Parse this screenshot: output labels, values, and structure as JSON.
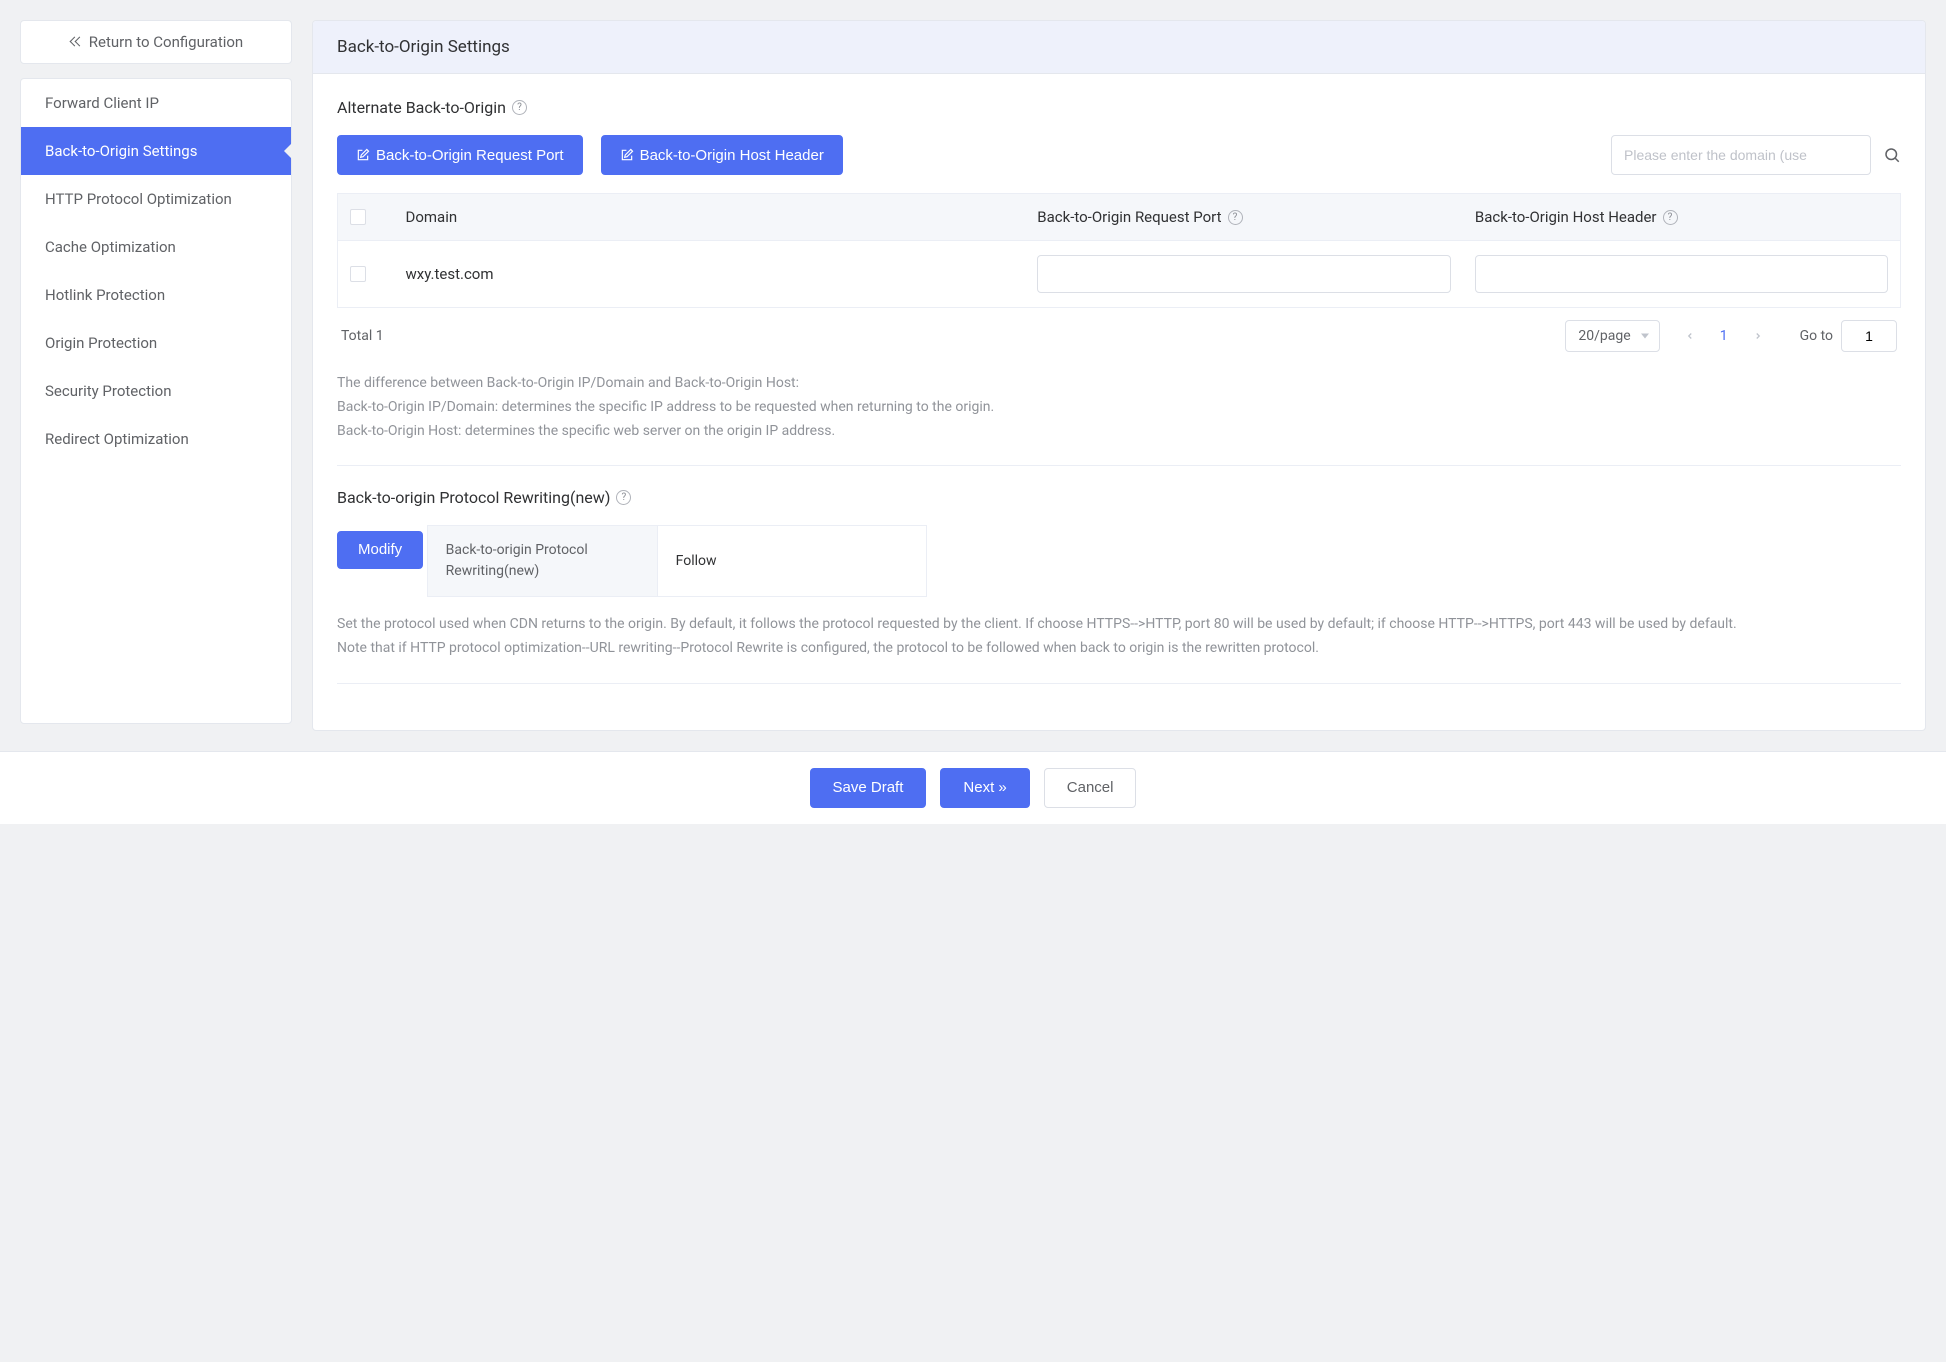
{
  "sidebar": {
    "return_label": "Return to Configuration",
    "items": [
      {
        "label": "Forward Client IP"
      },
      {
        "label": "Back-to-Origin Settings"
      },
      {
        "label": "HTTP Protocol Optimization"
      },
      {
        "label": "Cache Optimization"
      },
      {
        "label": "Hotlink Protection"
      },
      {
        "label": "Origin Protection"
      },
      {
        "label": "Security Protection"
      },
      {
        "label": "Redirect Optimization"
      }
    ],
    "active_index": 1
  },
  "header": {
    "title": "Back-to-Origin Settings"
  },
  "alternate": {
    "title": "Alternate Back-to-Origin",
    "btn_request_port": "Back-to-Origin Request Port",
    "btn_host_header": "Back-to-Origin Host Header",
    "search_placeholder": "Please enter the domain (use",
    "table": {
      "col_domain": "Domain",
      "col_request_port": "Back-to-Origin Request Port",
      "col_host_header": "Back-to-Origin Host Header",
      "rows": [
        {
          "domain": "wxy.test.com",
          "request_port": "",
          "host_header": ""
        }
      ]
    },
    "total_label": "Total",
    "total_value": "1",
    "page_size_label": "20/page",
    "current_page": "1",
    "goto_label": "Go to",
    "goto_value": "1",
    "help_line1": "The difference between Back-to-Origin IP/Domain and Back-to-Origin Host:",
    "help_line2": "Back-to-Origin IP/Domain: determines the specific IP address to be requested when returning to the origin.",
    "help_line3": "Back-to-Origin Host: determines the specific web server on the origin IP address."
  },
  "protocol": {
    "title": "Back-to-origin Protocol Rewriting(new)",
    "modify_label": "Modify",
    "kv_key": "Back-to-origin Protocol Rewriting(new)",
    "kv_value": "Follow",
    "help1": "Set the protocol used when CDN returns to the origin. By default, it follows the protocol requested by the client. If choose HTTPS-->HTTP, port 80 will be used by default; if choose HTTP-->HTTPS, port 443 will be used by default.",
    "help2": "Note that if HTTP protocol optimization--URL rewriting--Protocol Rewrite is configured, the protocol to be followed when back to origin is the rewritten protocol."
  },
  "footer": {
    "save_draft": "Save Draft",
    "next": "Next »",
    "cancel": "Cancel"
  }
}
